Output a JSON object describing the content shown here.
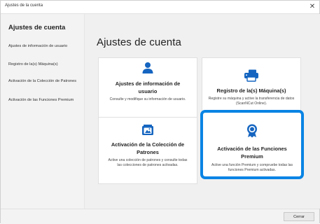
{
  "window": {
    "title": "Ajustes de la cuenta",
    "close_glyph": "✕"
  },
  "sidebar": {
    "title": "Ajustes de cuenta",
    "items": [
      {
        "label": "Ajustes de información de usuario"
      },
      {
        "label": "Registro de la(s) Máquina(s)"
      },
      {
        "label": "Activación de la Colección de Patrones"
      },
      {
        "label": "Activación de las Funciones Premium"
      }
    ]
  },
  "main": {
    "title": "Ajustes de cuenta",
    "cards": [
      {
        "icon": "user-icon",
        "title": "Ajustes de información de usuario",
        "desc": "Consulte y modifique su información de usuario."
      },
      {
        "icon": "machine-icon",
        "title": "Registro de la(s) Máquina(s)",
        "desc": "Registre su máquina y active la transferencia de datos (ScanNCut Online)."
      },
      {
        "icon": "pattern-collection-icon",
        "title": "Activación de la Colección de Patrones",
        "desc": "Active una colección de patrones y consulte todas las colecciones de patrones activadas."
      },
      {
        "icon": "premium-badge-icon",
        "title": "Activación de las Funciones Premium",
        "desc": "Active una función Premium y compruebe todas las funciones Premium activadas."
      }
    ]
  },
  "footer": {
    "close_label": "Cerrar"
  },
  "colors": {
    "accent": "#0a84e4",
    "icon": "#1565c0"
  }
}
